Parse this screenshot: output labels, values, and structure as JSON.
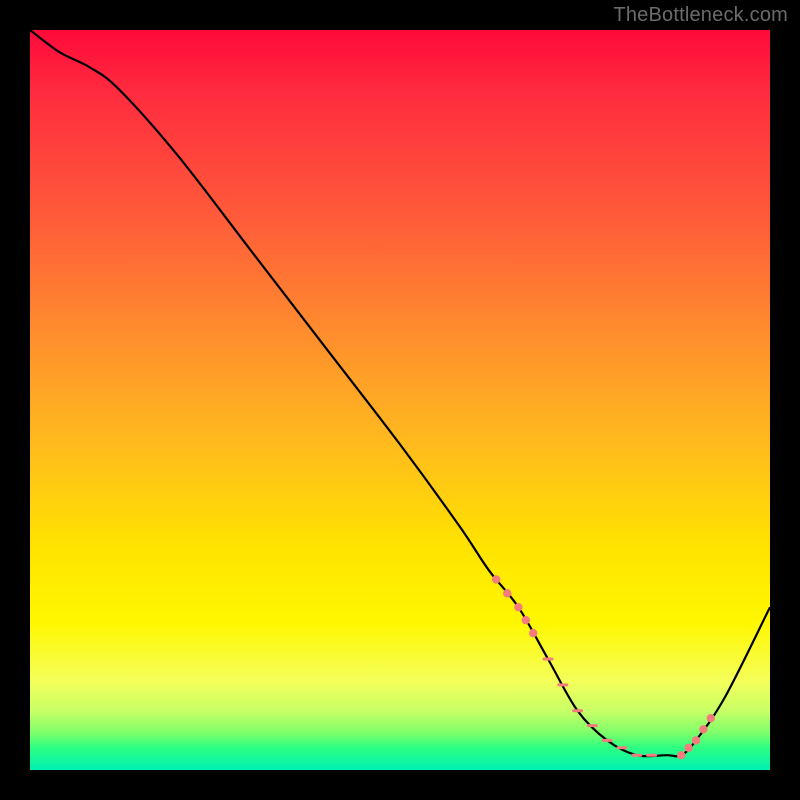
{
  "attribution": "TheBottleneck.com",
  "colors": {
    "frame_bg": "#000000",
    "gradient_top": "#ff0a3a",
    "gradient_mid1": "#ff8a2e",
    "gradient_mid2": "#ffe400",
    "gradient_bottom": "#00f0b4",
    "curve_stroke": "#000000",
    "tick_color": "#f47c7c"
  },
  "chart_data": {
    "type": "line",
    "title": "",
    "xlabel": "",
    "ylabel": "",
    "xlim": [
      0,
      100
    ],
    "ylim": [
      0,
      100
    ],
    "grid": false,
    "legend": false,
    "series": [
      {
        "name": "curve",
        "x": [
          0,
          4,
          8,
          12,
          20,
          30,
          40,
          50,
          58,
          62,
          66,
          70,
          74,
          78,
          82,
          86,
          88,
          90,
          94,
          100
        ],
        "y": [
          100,
          97,
          95,
          92,
          83,
          70,
          57,
          44,
          33,
          27,
          22,
          15,
          8,
          4,
          2,
          2,
          2,
          4,
          10,
          22
        ]
      }
    ],
    "ticks": {
      "note": "salmon dotted/dashed marks along the bottom of the V",
      "left_cluster_x": [
        63,
        64.5,
        66,
        67,
        68
      ],
      "plateau_dashes_x": [
        70,
        72,
        74,
        76,
        78,
        80,
        82,
        84
      ],
      "right_cluster_x": [
        88,
        89,
        90,
        91,
        92
      ]
    }
  }
}
